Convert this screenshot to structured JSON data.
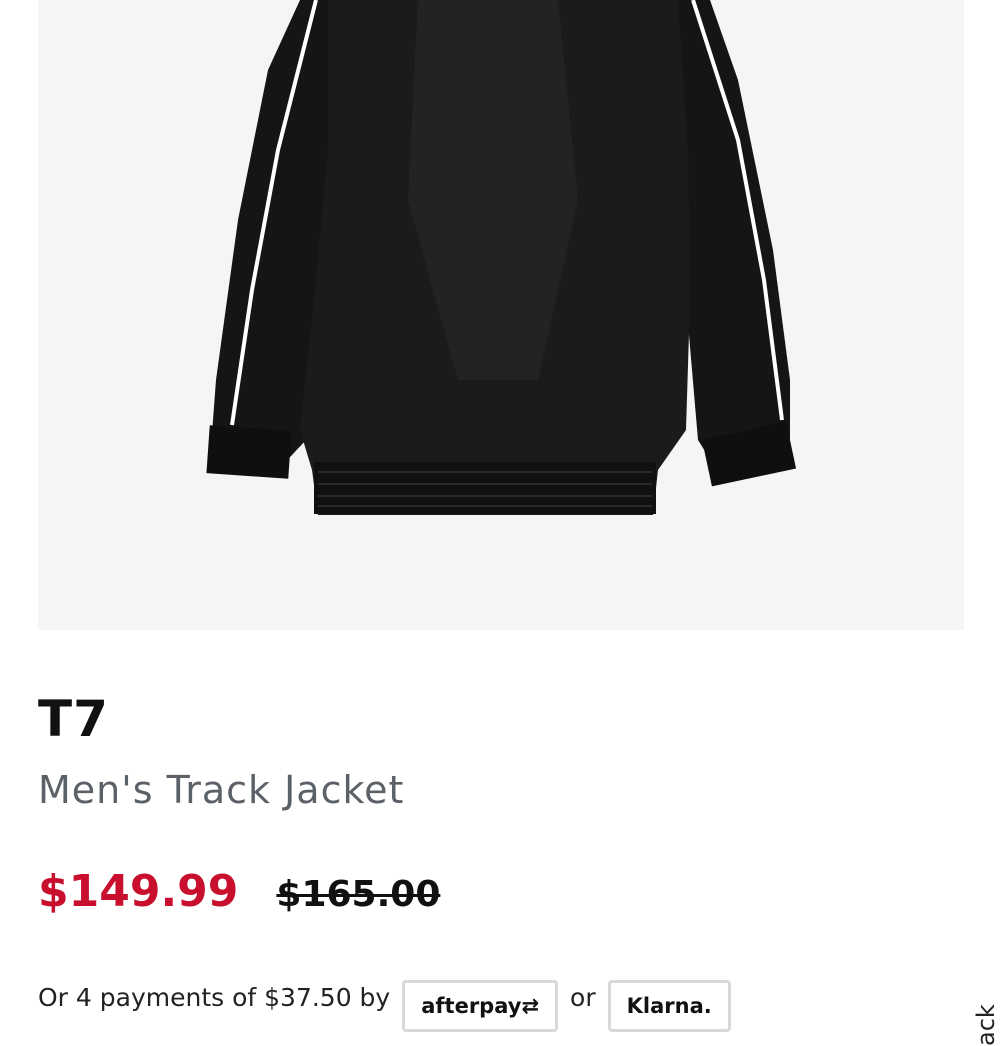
{
  "product": {
    "brand": "T7",
    "name": "Men's Track Jacket",
    "sale_price": "$149.99",
    "original_price": "$165.00",
    "image_alt": "Black track jacket"
  },
  "payments": {
    "prefix": "Or 4 payments of $37.50 by",
    "separator": "or",
    "afterpay_label": "afterpay",
    "klarna_label": "Klarna."
  },
  "feedback": {
    "label": "ack"
  },
  "colors": {
    "sale": "#c8102e",
    "image_bg": "#f5f5f5",
    "muted_text": "#5c6168"
  }
}
